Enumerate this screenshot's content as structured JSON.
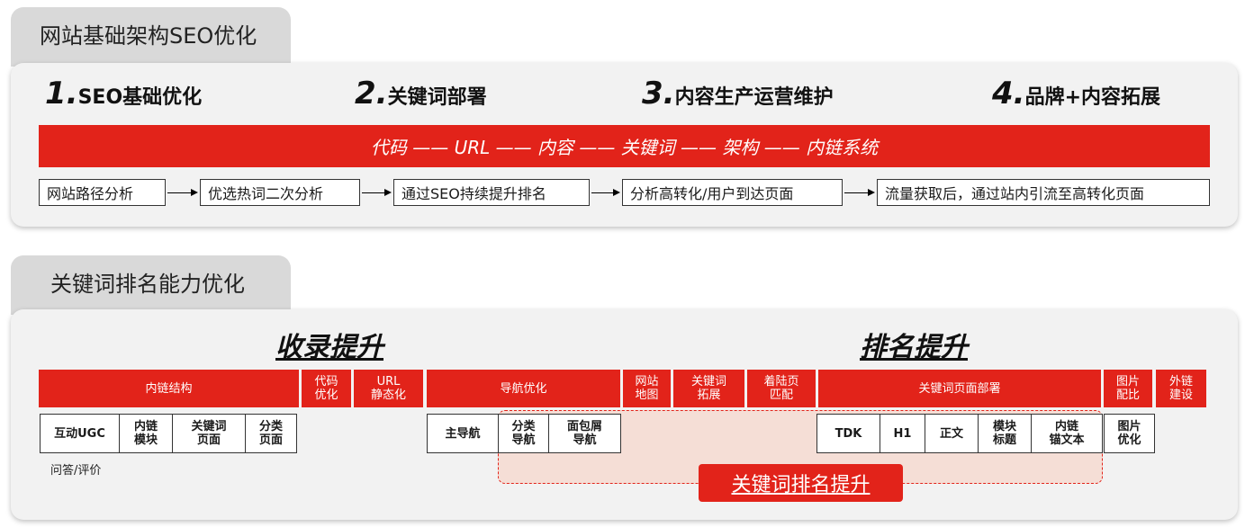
{
  "section1": {
    "tab_title": "网站基础架构SEO优化",
    "steps": [
      {
        "num": "1.",
        "label": "SEO基础优化"
      },
      {
        "num": "2.",
        "label": "关键词部署"
      },
      {
        "num": "3.",
        "label": "内容生产运营维护"
      },
      {
        "num": "4.",
        "label": "品牌+内容拓展"
      }
    ],
    "red_bar": "代码 —— URL —— 内容 —— 关键词 —— 架构 —— 内链系统",
    "flow": [
      "网站路径分析",
      "优选热词二次分析",
      "通过SEO持续提升排名",
      "分析高转化/用户到达页面",
      "流量获取后，通过站内引流至高转化页面"
    ]
  },
  "section2": {
    "tab_title": "关键词排名能力优化",
    "left_title": "收录提升",
    "right_title": "排名提升",
    "headers": {
      "inner_link": "内链结构",
      "code": "代码\n优化",
      "url": "URL\n静态化",
      "nav": "导航优化",
      "sitemap": "网站\n地图",
      "keyword_expand": "关键词\n拓展",
      "landing": "着陆页\n匹配",
      "keyword_page": "关键词页面部署",
      "image_ratio": "图片\n配比",
      "external_links": "外链\n建设"
    },
    "subs": {
      "ugc": "互动UGC",
      "link_module": "内链\n模块",
      "keyword_page": "关键词\n页面",
      "category_page": "分类\n页面",
      "main_nav": "主导航",
      "category_nav": "分类\n导航",
      "breadcrumb_nav": "面包屑\n导航",
      "tdk": "TDK",
      "h1": "H1",
      "body_text": "正文",
      "module_title": "模块\n标题",
      "anchor_text": "内链\n锚文本",
      "image_opt": "图片\n优化"
    },
    "note": "问答/评价",
    "highlight_label": "关键词排名提升"
  }
}
